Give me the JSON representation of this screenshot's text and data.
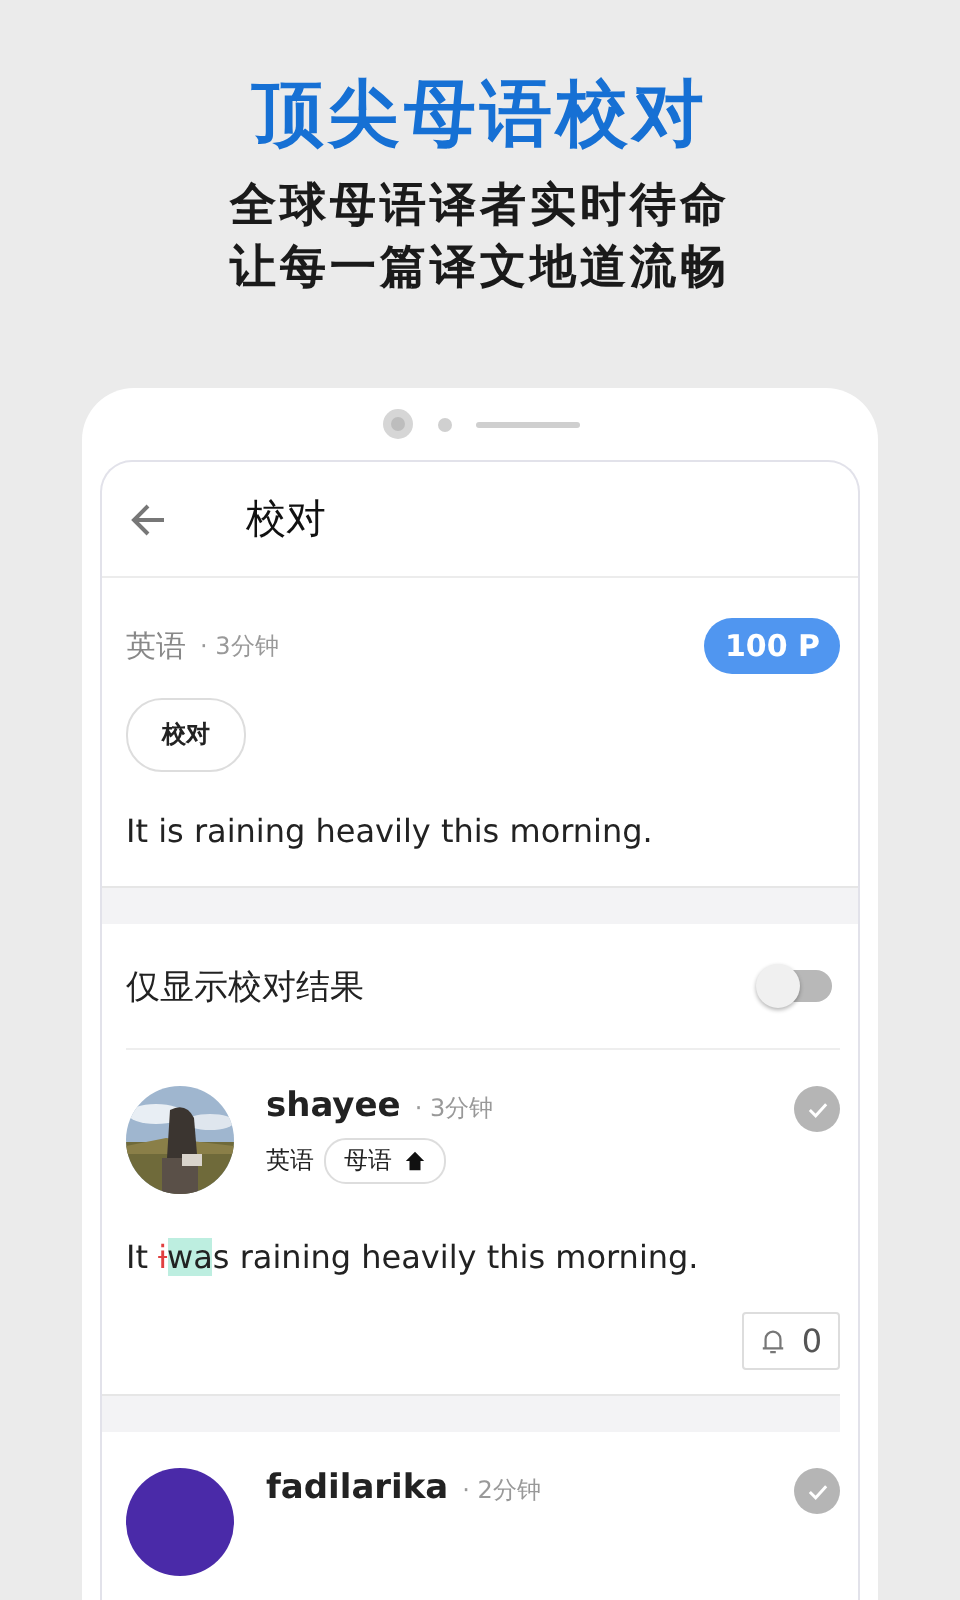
{
  "promo": {
    "headline": "顶尖母语校对",
    "lines": [
      "全球母语译者实时待命",
      "让每一篇译文地道流畅"
    ]
  },
  "screen": {
    "title": "校对",
    "request": {
      "language": "英语",
      "time": "· 3分钟",
      "points": "100 P",
      "tag": "校对",
      "text": "It is raining heavily this morning."
    },
    "filter": {
      "label": "仅显示校对结果",
      "on": false
    },
    "answers": [
      {
        "user": "shayee",
        "time": "· 3分钟",
        "kind": "picture",
        "language": "英语",
        "badge": "母语",
        "likes": "0",
        "segments": [
          {
            "kind": "plain",
            "text": "It "
          },
          {
            "kind": "deleted",
            "text": "i"
          },
          {
            "kind": "inserted",
            "text": "wa"
          },
          {
            "kind": "plain",
            "text": "s raining heavily this morning."
          }
        ]
      },
      {
        "user": "fadilarika",
        "time": "· 2分钟",
        "kind": "plain",
        "color": "#4a2aa8"
      }
    ]
  }
}
